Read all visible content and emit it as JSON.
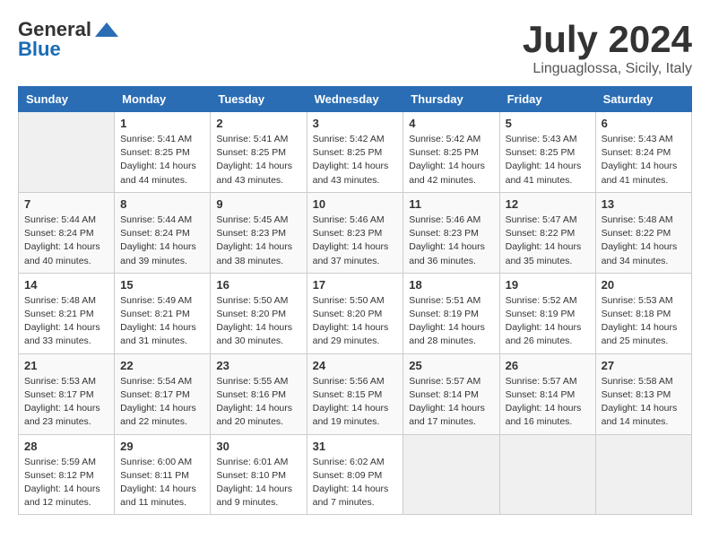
{
  "logo": {
    "general": "General",
    "blue": "Blue"
  },
  "title": "July 2024",
  "location": "Linguaglossa, Sicily, Italy",
  "days_of_week": [
    "Sunday",
    "Monday",
    "Tuesday",
    "Wednesday",
    "Thursday",
    "Friday",
    "Saturday"
  ],
  "weeks": [
    [
      {
        "day": "",
        "sunrise": "",
        "sunset": "",
        "daylight": ""
      },
      {
        "day": "1",
        "sunrise": "Sunrise: 5:41 AM",
        "sunset": "Sunset: 8:25 PM",
        "daylight": "Daylight: 14 hours and 44 minutes."
      },
      {
        "day": "2",
        "sunrise": "Sunrise: 5:41 AM",
        "sunset": "Sunset: 8:25 PM",
        "daylight": "Daylight: 14 hours and 43 minutes."
      },
      {
        "day": "3",
        "sunrise": "Sunrise: 5:42 AM",
        "sunset": "Sunset: 8:25 PM",
        "daylight": "Daylight: 14 hours and 43 minutes."
      },
      {
        "day": "4",
        "sunrise": "Sunrise: 5:42 AM",
        "sunset": "Sunset: 8:25 PM",
        "daylight": "Daylight: 14 hours and 42 minutes."
      },
      {
        "day": "5",
        "sunrise": "Sunrise: 5:43 AM",
        "sunset": "Sunset: 8:25 PM",
        "daylight": "Daylight: 14 hours and 41 minutes."
      },
      {
        "day": "6",
        "sunrise": "Sunrise: 5:43 AM",
        "sunset": "Sunset: 8:24 PM",
        "daylight": "Daylight: 14 hours and 41 minutes."
      }
    ],
    [
      {
        "day": "7",
        "sunrise": "Sunrise: 5:44 AM",
        "sunset": "Sunset: 8:24 PM",
        "daylight": "Daylight: 14 hours and 40 minutes."
      },
      {
        "day": "8",
        "sunrise": "Sunrise: 5:44 AM",
        "sunset": "Sunset: 8:24 PM",
        "daylight": "Daylight: 14 hours and 39 minutes."
      },
      {
        "day": "9",
        "sunrise": "Sunrise: 5:45 AM",
        "sunset": "Sunset: 8:23 PM",
        "daylight": "Daylight: 14 hours and 38 minutes."
      },
      {
        "day": "10",
        "sunrise": "Sunrise: 5:46 AM",
        "sunset": "Sunset: 8:23 PM",
        "daylight": "Daylight: 14 hours and 37 minutes."
      },
      {
        "day": "11",
        "sunrise": "Sunrise: 5:46 AM",
        "sunset": "Sunset: 8:23 PM",
        "daylight": "Daylight: 14 hours and 36 minutes."
      },
      {
        "day": "12",
        "sunrise": "Sunrise: 5:47 AM",
        "sunset": "Sunset: 8:22 PM",
        "daylight": "Daylight: 14 hours and 35 minutes."
      },
      {
        "day": "13",
        "sunrise": "Sunrise: 5:48 AM",
        "sunset": "Sunset: 8:22 PM",
        "daylight": "Daylight: 14 hours and 34 minutes."
      }
    ],
    [
      {
        "day": "14",
        "sunrise": "Sunrise: 5:48 AM",
        "sunset": "Sunset: 8:21 PM",
        "daylight": "Daylight: 14 hours and 33 minutes."
      },
      {
        "day": "15",
        "sunrise": "Sunrise: 5:49 AM",
        "sunset": "Sunset: 8:21 PM",
        "daylight": "Daylight: 14 hours and 31 minutes."
      },
      {
        "day": "16",
        "sunrise": "Sunrise: 5:50 AM",
        "sunset": "Sunset: 8:20 PM",
        "daylight": "Daylight: 14 hours and 30 minutes."
      },
      {
        "day": "17",
        "sunrise": "Sunrise: 5:50 AM",
        "sunset": "Sunset: 8:20 PM",
        "daylight": "Daylight: 14 hours and 29 minutes."
      },
      {
        "day": "18",
        "sunrise": "Sunrise: 5:51 AM",
        "sunset": "Sunset: 8:19 PM",
        "daylight": "Daylight: 14 hours and 28 minutes."
      },
      {
        "day": "19",
        "sunrise": "Sunrise: 5:52 AM",
        "sunset": "Sunset: 8:19 PM",
        "daylight": "Daylight: 14 hours and 26 minutes."
      },
      {
        "day": "20",
        "sunrise": "Sunrise: 5:53 AM",
        "sunset": "Sunset: 8:18 PM",
        "daylight": "Daylight: 14 hours and 25 minutes."
      }
    ],
    [
      {
        "day": "21",
        "sunrise": "Sunrise: 5:53 AM",
        "sunset": "Sunset: 8:17 PM",
        "daylight": "Daylight: 14 hours and 23 minutes."
      },
      {
        "day": "22",
        "sunrise": "Sunrise: 5:54 AM",
        "sunset": "Sunset: 8:17 PM",
        "daylight": "Daylight: 14 hours and 22 minutes."
      },
      {
        "day": "23",
        "sunrise": "Sunrise: 5:55 AM",
        "sunset": "Sunset: 8:16 PM",
        "daylight": "Daylight: 14 hours and 20 minutes."
      },
      {
        "day": "24",
        "sunrise": "Sunrise: 5:56 AM",
        "sunset": "Sunset: 8:15 PM",
        "daylight": "Daylight: 14 hours and 19 minutes."
      },
      {
        "day": "25",
        "sunrise": "Sunrise: 5:57 AM",
        "sunset": "Sunset: 8:14 PM",
        "daylight": "Daylight: 14 hours and 17 minutes."
      },
      {
        "day": "26",
        "sunrise": "Sunrise: 5:57 AM",
        "sunset": "Sunset: 8:14 PM",
        "daylight": "Daylight: 14 hours and 16 minutes."
      },
      {
        "day": "27",
        "sunrise": "Sunrise: 5:58 AM",
        "sunset": "Sunset: 8:13 PM",
        "daylight": "Daylight: 14 hours and 14 minutes."
      }
    ],
    [
      {
        "day": "28",
        "sunrise": "Sunrise: 5:59 AM",
        "sunset": "Sunset: 8:12 PM",
        "daylight": "Daylight: 14 hours and 12 minutes."
      },
      {
        "day": "29",
        "sunrise": "Sunrise: 6:00 AM",
        "sunset": "Sunset: 8:11 PM",
        "daylight": "Daylight: 14 hours and 11 minutes."
      },
      {
        "day": "30",
        "sunrise": "Sunrise: 6:01 AM",
        "sunset": "Sunset: 8:10 PM",
        "daylight": "Daylight: 14 hours and 9 minutes."
      },
      {
        "day": "31",
        "sunrise": "Sunrise: 6:02 AM",
        "sunset": "Sunset: 8:09 PM",
        "daylight": "Daylight: 14 hours and 7 minutes."
      },
      {
        "day": "",
        "sunrise": "",
        "sunset": "",
        "daylight": ""
      },
      {
        "day": "",
        "sunrise": "",
        "sunset": "",
        "daylight": ""
      },
      {
        "day": "",
        "sunrise": "",
        "sunset": "",
        "daylight": ""
      }
    ]
  ]
}
